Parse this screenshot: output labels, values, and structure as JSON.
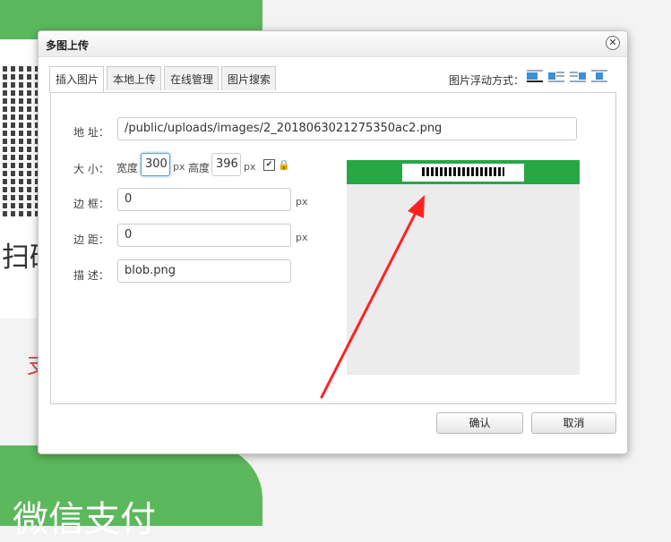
{
  "background": {
    "scan_text": "扫码",
    "red_text": "支",
    "wechat_pay_text": "微信支付"
  },
  "dialog": {
    "title": "多图上传",
    "close_glyph": "✕"
  },
  "tabs": [
    {
      "label": "插入图片",
      "active": true
    },
    {
      "label": "本地上传",
      "active": false
    },
    {
      "label": "在线管理",
      "active": false
    },
    {
      "label": "图片搜索",
      "active": false
    }
  ],
  "float": {
    "label": "图片浮动方式：",
    "options": [
      "float-none-icon",
      "float-left-icon",
      "float-right-icon",
      "float-center-icon"
    ]
  },
  "form": {
    "address_label": "地 址：",
    "address_value": "/public/uploads/images/2_2018063021275350ac2.png",
    "size_label": "大 小：",
    "width_label": "宽度",
    "width_value": "300",
    "px1": "px",
    "height_label": "高度",
    "height_value": "396",
    "px2": "px",
    "lock_checked": "✔",
    "border_label": "边 框：",
    "border_value": "0",
    "border_unit": "px",
    "margin_label": "边 距：",
    "margin_value": "0",
    "margin_unit": "px",
    "desc_label": "描 述：",
    "desc_value": "blob.png"
  },
  "buttons": {
    "confirm": "确认",
    "cancel": "取消"
  }
}
